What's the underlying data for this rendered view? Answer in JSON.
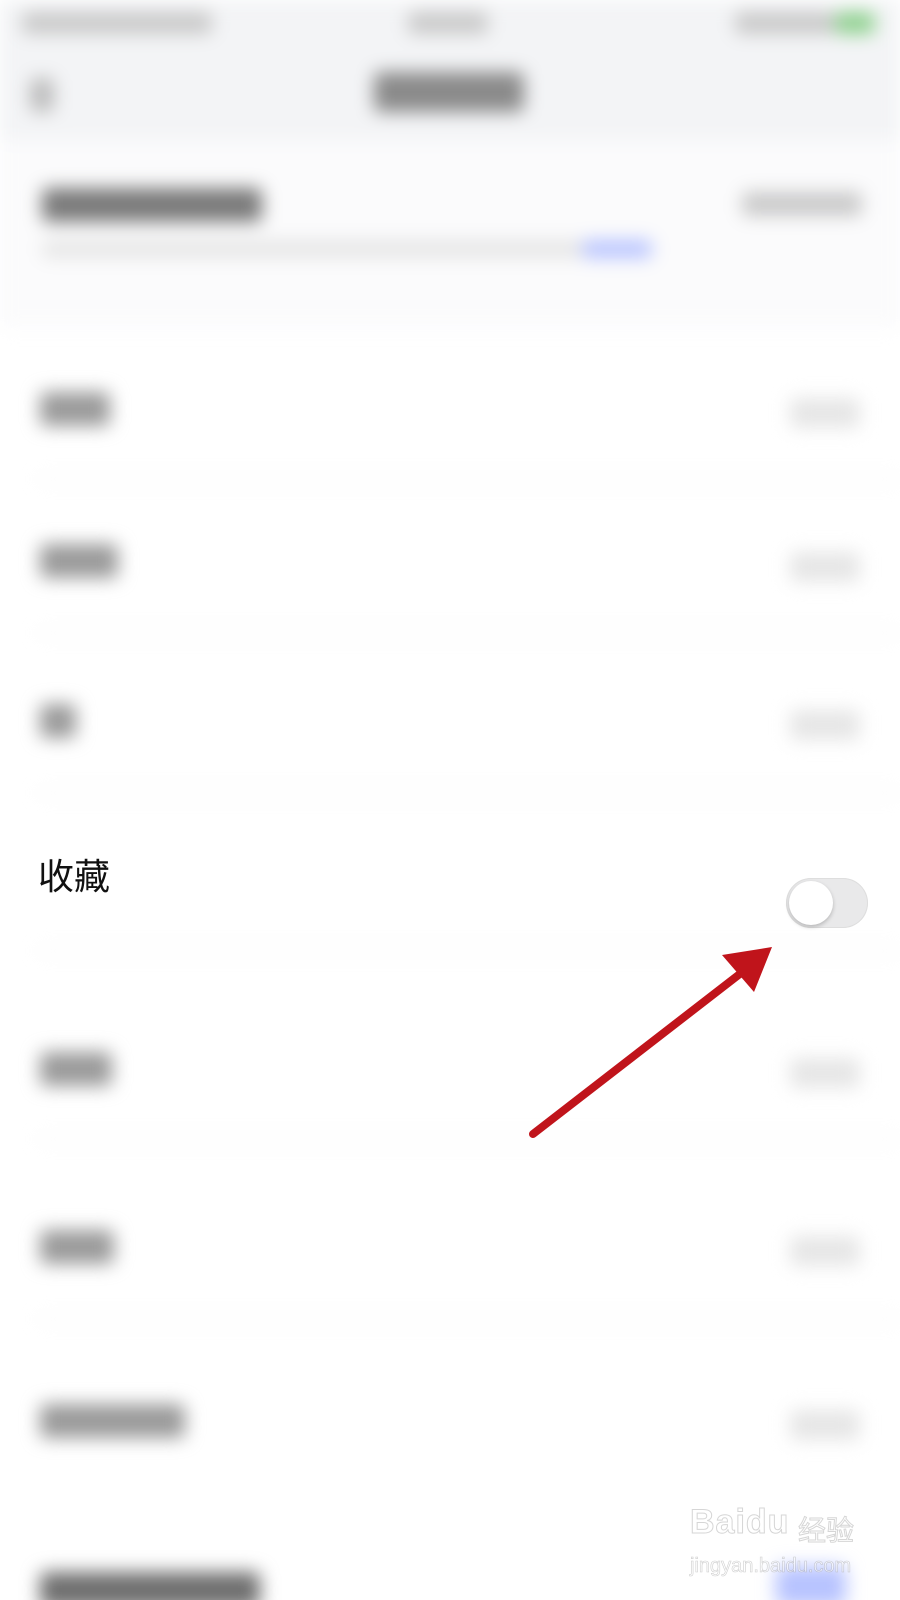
{
  "favorites_row": {
    "label": "收藏",
    "toggle_on": false
  },
  "annotation": {
    "arrow_color": "#c0141b"
  },
  "watermark": {
    "logo": "Baidu",
    "brand_cn": "经验",
    "url": "jingyan.baidu.com"
  },
  "colors": {
    "background": "#ffffff",
    "toggle_off_track": "#e9e9ea",
    "blurred_link": "#b7c3ff"
  }
}
